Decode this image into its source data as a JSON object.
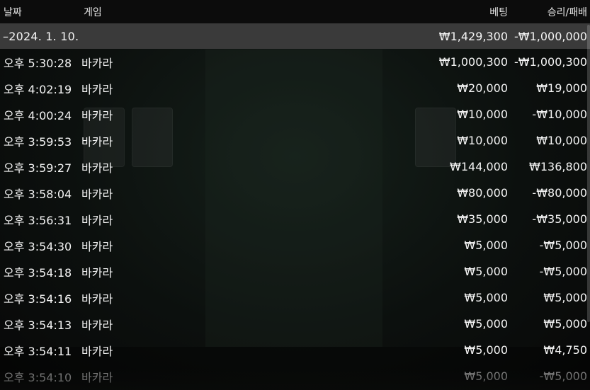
{
  "header": {
    "date_label": "날짜",
    "game_label": "게임",
    "bet_label": "베팅",
    "result_label": "승리/패배"
  },
  "summary": {
    "date": "–2024. 1. 10.",
    "bet": "₩1,429,300",
    "result": "-₩1,000,000"
  },
  "rows": [
    {
      "time": "오후 5:30:28",
      "game": "바카라",
      "bet": "₩1,000,300",
      "result": "-₩1,000,300"
    },
    {
      "time": "오후 4:02:19",
      "game": "바카라",
      "bet": "₩20,000",
      "result": "₩19,000"
    },
    {
      "time": "오후 4:00:24",
      "game": "바카라",
      "bet": "₩10,000",
      "result": "-₩10,000"
    },
    {
      "time": "오후 3:59:53",
      "game": "바카라",
      "bet": "₩10,000",
      "result": "₩10,000"
    },
    {
      "time": "오후 3:59:27",
      "game": "바카라",
      "bet": "₩144,000",
      "result": "₩136,800"
    },
    {
      "time": "오후 3:58:04",
      "game": "바카라",
      "bet": "₩80,000",
      "result": "-₩80,000"
    },
    {
      "time": "오후 3:56:31",
      "game": "바카라",
      "bet": "₩35,000",
      "result": "-₩35,000"
    },
    {
      "time": "오후 3:54:30",
      "game": "바카라",
      "bet": "₩5,000",
      "result": "-₩5,000"
    },
    {
      "time": "오후 3:54:18",
      "game": "바카라",
      "bet": "₩5,000",
      "result": "-₩5,000"
    },
    {
      "time": "오후 3:54:16",
      "game": "바카라",
      "bet": "₩5,000",
      "result": "₩5,000"
    },
    {
      "time": "오후 3:54:13",
      "game": "바카라",
      "bet": "₩5,000",
      "result": "₩5,000"
    },
    {
      "time": "오후 3:54:11",
      "game": "바카라",
      "bet": "₩5,000",
      "result": "₩4,750"
    },
    {
      "time": "오후 3:54:10",
      "game": "바카라",
      "bet": "₩5,000",
      "result": "-₩5,000"
    }
  ]
}
